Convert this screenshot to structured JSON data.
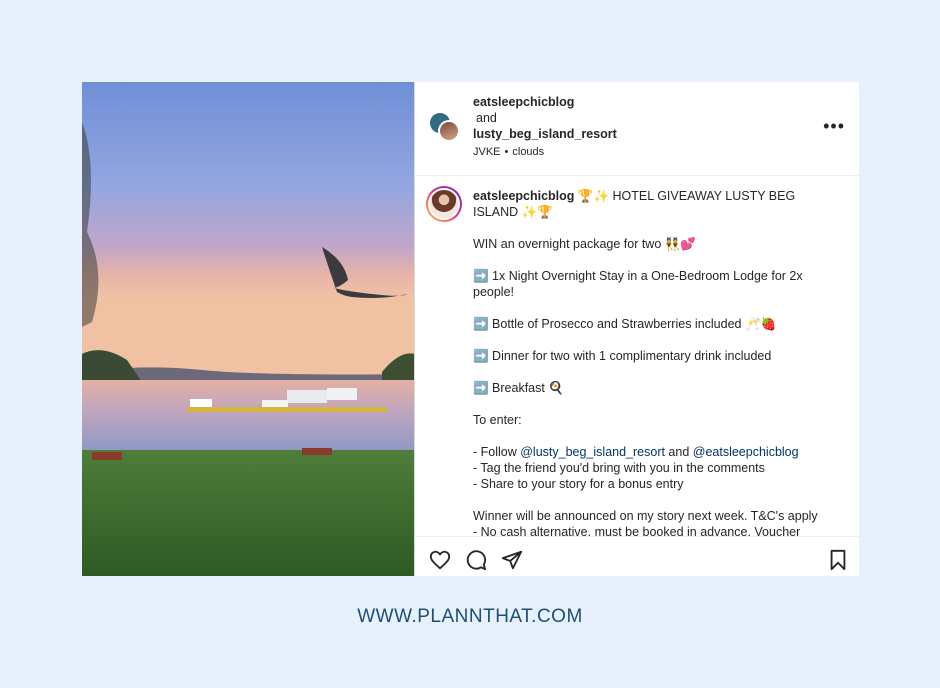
{
  "post": {
    "header": {
      "user1": "eatsleepchicblog",
      "and": "and",
      "user2": "lusty_beg_island_resort",
      "music_artist": "JVKE",
      "music_track": "clouds",
      "more_label": "•••"
    },
    "caption": {
      "user": "eatsleepchicblog",
      "title": " 🏆✨ HOTEL GIVEAWAY LUSTY BEG ISLAND ✨🏆",
      "lines": [
        "WIN an overnight package for two 👯💕",
        "➡️ 1x Night Overnight Stay in a One-Bedroom Lodge for 2x people!",
        "➡️ Bottle of Prosecco and Strawberries included 🥂🍓",
        "➡️ Dinner for two with 1 complimentary drink included",
        "➡️ Breakfast 🍳",
        "To enter:"
      ],
      "follow_prefix": "- Follow ",
      "follow_mention1": "@lusty_beg_island_resort",
      "follow_and": " and ",
      "follow_mention2": "@eatsleepchicblog",
      "tag_line": "- Tag the friend you'd bring with you in the comments",
      "share_line": "- Share to your story for a bonus entry",
      "winner_line": "Winner will be announced on my story next week. T&C's apply",
      "cut_line": "- No cash alternative, must be booked in advance. Voucher"
    },
    "actions": [
      "heart-icon",
      "comment-icon",
      "share-icon",
      "bookmark-icon"
    ]
  },
  "footer": {
    "url": "WWW.PLANNTHAT.COM"
  },
  "colors": {
    "background": "#e6f1fd",
    "mention": "#00376b",
    "footer_text": "#1d4f74"
  }
}
